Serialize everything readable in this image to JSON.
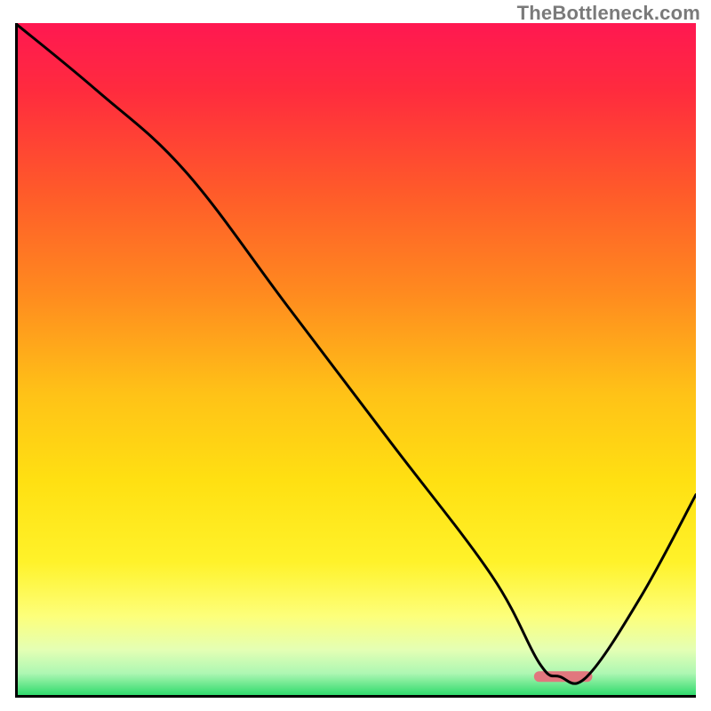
{
  "watermark": "TheBottleneck.com",
  "chart_data": {
    "type": "line",
    "title": "",
    "xlabel": "",
    "ylabel": "",
    "xlim": [
      0,
      100
    ],
    "ylim": [
      0,
      100
    ],
    "series": [
      {
        "name": "bottleneck-curve",
        "x": [
          0,
          12,
          25,
          40,
          55,
          70,
          77,
          80,
          84,
          92,
          100
        ],
        "values": [
          100,
          90,
          78,
          58,
          38,
          18,
          5,
          3,
          3,
          15,
          30
        ]
      }
    ],
    "gradient_stops": [
      {
        "offset": 0.0,
        "color": "#ff1851"
      },
      {
        "offset": 0.1,
        "color": "#ff2b3e"
      },
      {
        "offset": 0.25,
        "color": "#ff5a2a"
      },
      {
        "offset": 0.4,
        "color": "#ff8a1f"
      },
      {
        "offset": 0.55,
        "color": "#ffc217"
      },
      {
        "offset": 0.68,
        "color": "#ffe012"
      },
      {
        "offset": 0.8,
        "color": "#fff22a"
      },
      {
        "offset": 0.88,
        "color": "#fdff7a"
      },
      {
        "offset": 0.93,
        "color": "#e4ffb4"
      },
      {
        "offset": 0.965,
        "color": "#aef7b3"
      },
      {
        "offset": 1.0,
        "color": "#26d867"
      }
    ],
    "marker": {
      "name": "optimal-range",
      "x_start": 77,
      "x_end": 84,
      "y": 3,
      "color": "#e1777e",
      "thickness_px": 12
    },
    "colors": {
      "curve": "#000000",
      "axis": "#000000",
      "background": "#ffffff"
    }
  }
}
